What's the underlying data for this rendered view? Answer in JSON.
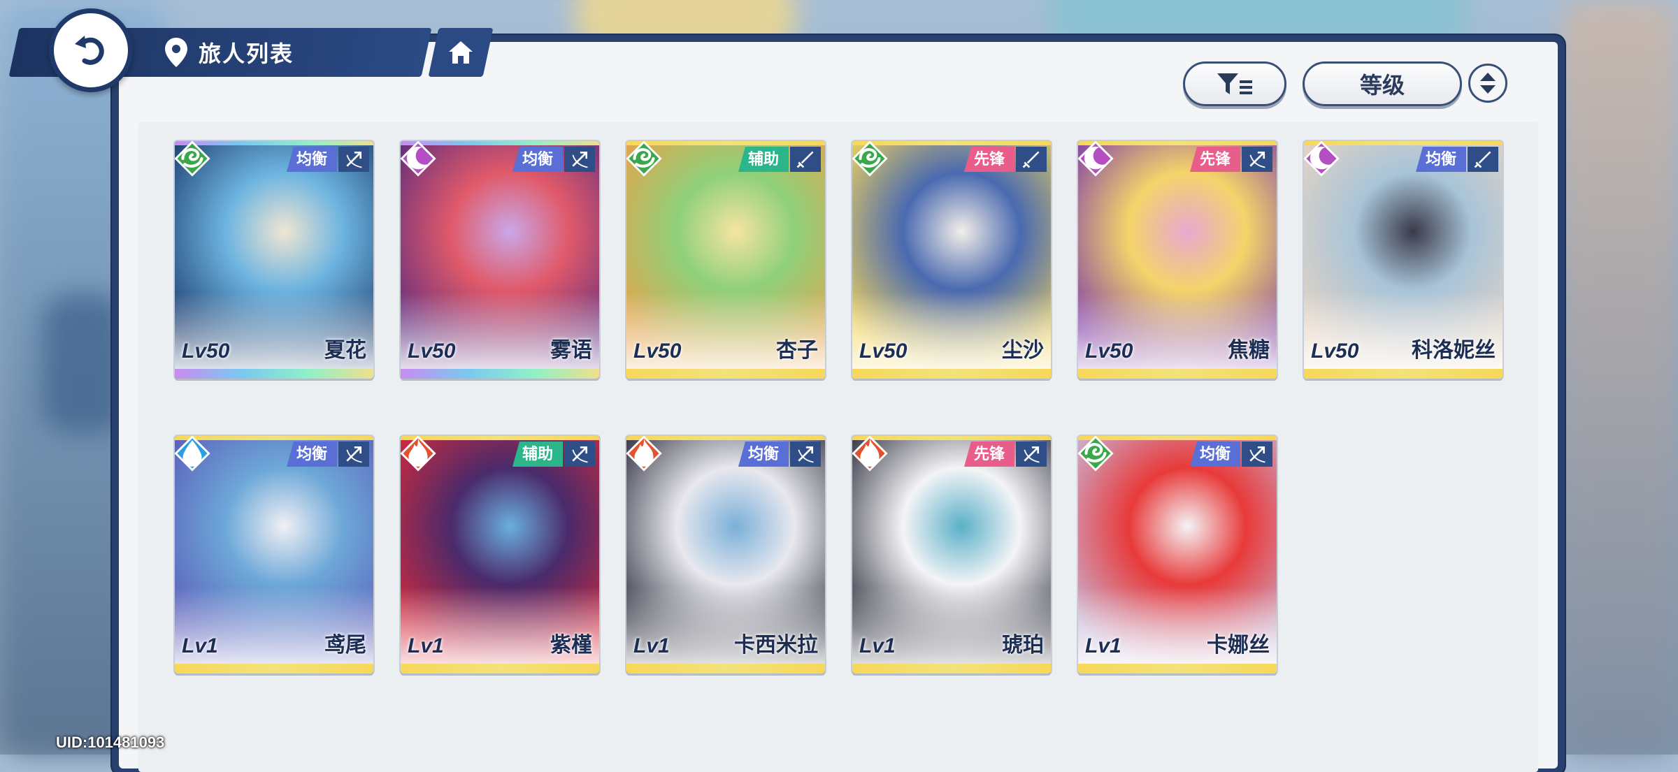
{
  "header": {
    "title": "旅人列表"
  },
  "controls": {
    "sort_label": "等级"
  },
  "colors": {
    "role_balance": "#5a6fd6",
    "role_support": "#2ab58a",
    "role_vanguard": "#e85d8a",
    "element_wind": "#3aa84a",
    "element_moon": "#b34fc2",
    "element_water": "#2a9ee0",
    "element_fire": "#e2522c"
  },
  "characters": [
    {
      "level": "Lv50",
      "name": "夏花",
      "role": "均衡",
      "element": "wind-icon",
      "weapon": "bow-icon",
      "rarity": "rainbow",
      "art": [
        "#1b3a6b",
        "#6db4e0",
        "#f0e6d2"
      ]
    },
    {
      "level": "Lv50",
      "name": "雾语",
      "role": "均衡",
      "element": "moon-icon",
      "weapon": "bow-icon",
      "rarity": "rainbow",
      "art": [
        "#5a2a7e",
        "#e05a6a",
        "#c9a8e8"
      ]
    },
    {
      "level": "Lv50",
      "name": "杏子",
      "role": "辅助",
      "element": "wind-icon",
      "weapon": "sword-icon",
      "rarity": "gold",
      "art": [
        "#e8a24a",
        "#8fd07a",
        "#f6e4a2"
      ]
    },
    {
      "level": "Lv50",
      "name": "尘沙",
      "role": "先锋",
      "element": "wind-icon",
      "weapon": "sword-icon",
      "rarity": "gold",
      "art": [
        "#f5d65a",
        "#4a6ab0",
        "#f2efe8"
      ]
    },
    {
      "level": "Lv50",
      "name": "焦糖",
      "role": "先锋",
      "element": "moon-icon",
      "weapon": "bow-icon",
      "rarity": "gold",
      "art": [
        "#7e3aa8",
        "#f4d46a",
        "#e8a8d0"
      ]
    },
    {
      "level": "Lv50",
      "name": "科洛妮丝",
      "role": "均衡",
      "element": "moon-icon",
      "weapon": "sword-icon",
      "rarity": "gold",
      "art": [
        "#e8d4c2",
        "#a8c4d8",
        "#3a3a4a"
      ]
    },
    {
      "level": "Lv1",
      "name": "鸢尾",
      "role": "均衡",
      "element": "water-icon",
      "weapon": "bow-icon",
      "rarity": "gold",
      "art": [
        "#5a5ab8",
        "#6da8d8",
        "#f0f0f4"
      ]
    },
    {
      "level": "Lv1",
      "name": "紫槿",
      "role": "辅助",
      "element": "fire-icon",
      "weapon": "bow-icon",
      "rarity": "gold",
      "art": [
        "#d82a3a",
        "#4a2a6a",
        "#6ab0e0"
      ]
    },
    {
      "level": "Lv1",
      "name": "卡西米拉",
      "role": "均衡",
      "element": "fire-icon",
      "weapon": "bow-icon",
      "rarity": "gold",
      "art": [
        "#2a2a3a",
        "#e8e8ee",
        "#7ab0d8"
      ]
    },
    {
      "level": "Lv1",
      "name": "琥珀",
      "role": "先锋",
      "element": "fire-icon",
      "weapon": "bow-icon",
      "rarity": "gold",
      "art": [
        "#2a2a3a",
        "#f4f4f6",
        "#5ab0c8"
      ]
    },
    {
      "level": "Lv1",
      "name": "卡娜丝",
      "role": "均衡",
      "element": "wind-icon",
      "weapon": "bow-icon",
      "rarity": "gold",
      "art": [
        "#c8b8d8",
        "#e83a3a",
        "#f4f4f6"
      ]
    }
  ],
  "footer": {
    "uid": "UID:101481093"
  }
}
